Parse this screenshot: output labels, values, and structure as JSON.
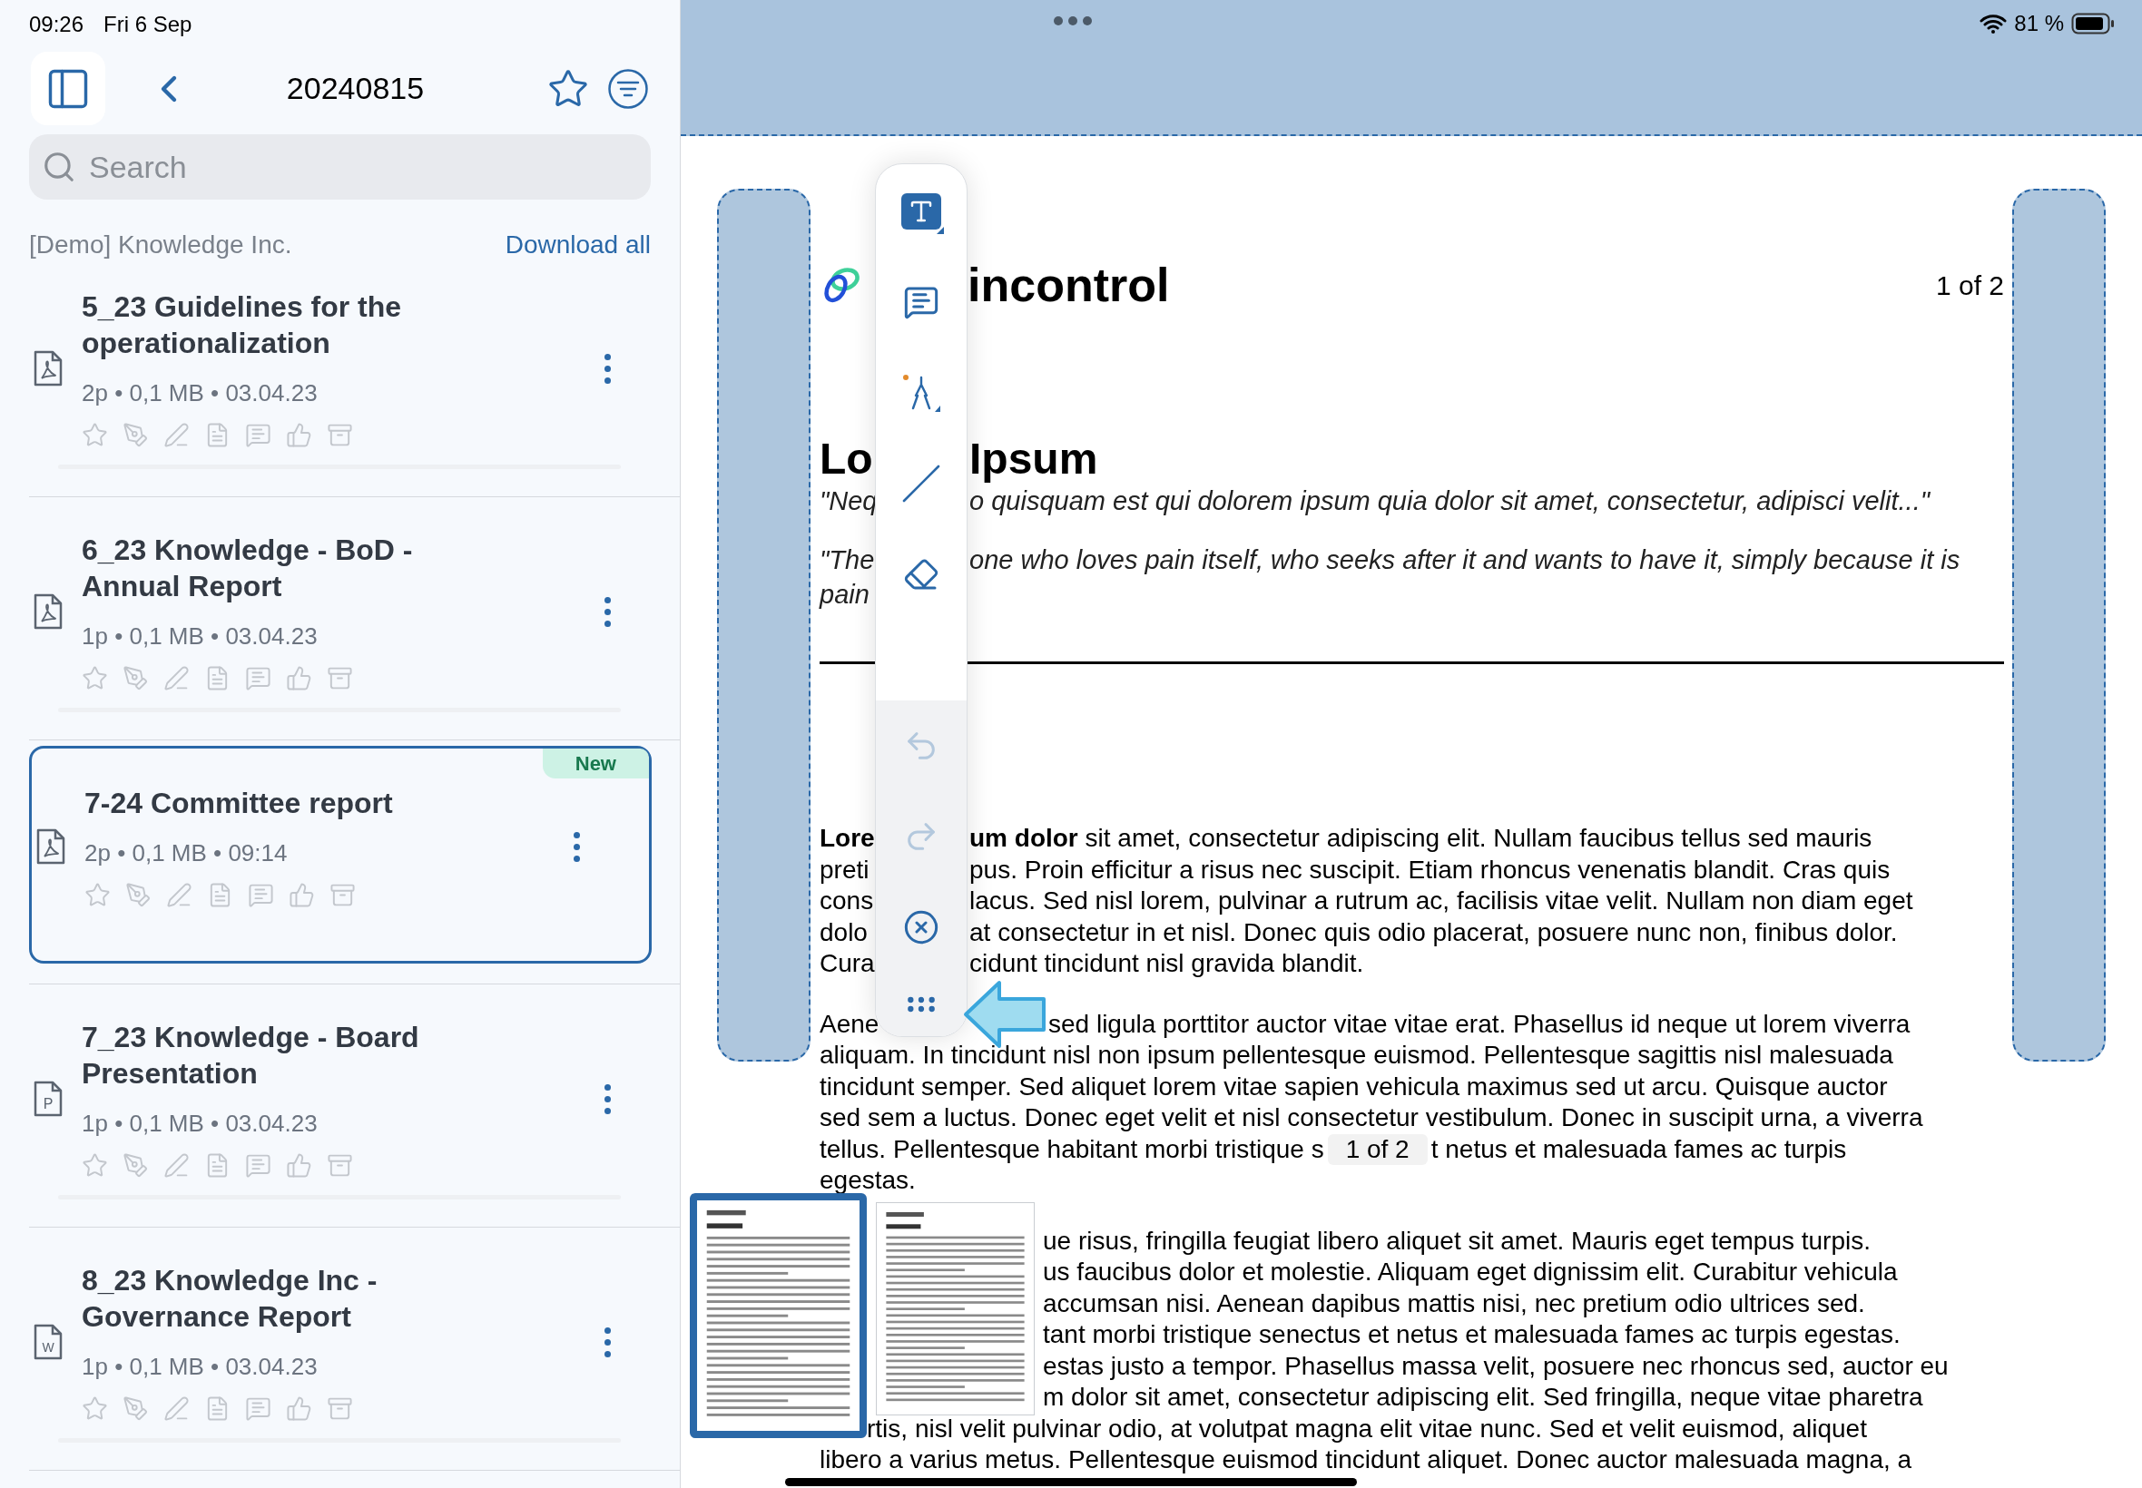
{
  "status_bar": {
    "time": "09:26",
    "date": "Fri 6 Sep",
    "battery": "81 %"
  },
  "header": {
    "title": "20240815"
  },
  "search": {
    "placeholder": "Search"
  },
  "section": {
    "title": "[Demo] Knowledge Inc.",
    "action": "Download all"
  },
  "documents": [
    {
      "title": "5_23 Guidelines for the operationalization",
      "meta": "2p • 0,1 MB • 03.04.23",
      "kind": "pdf",
      "selected": false
    },
    {
      "title": "6_23 Knowledge - BoD - Annual Report",
      "meta": "1p • 0,1 MB • 03.04.23",
      "kind": "pdf",
      "selected": false
    },
    {
      "title": "7-24 Committee report",
      "meta": "2p • 0,1 MB • 09:14",
      "kind": "pdf",
      "selected": true,
      "badge": "New"
    },
    {
      "title": "7_23 Knowledge - Board Presentation",
      "meta": "1p • 0,1 MB • 03.04.23",
      "kind": "ppt",
      "file_letter": "P",
      "selected": false
    },
    {
      "title": "8_23 Knowledge Inc - Governance Report",
      "meta": "1p • 0,1 MB • 03.04.23",
      "kind": "word",
      "file_letter": "W",
      "selected": false
    }
  ],
  "toolbar": {
    "tools": [
      {
        "kind": "text",
        "selected": true
      },
      {
        "kind": "comment",
        "selected": false
      },
      {
        "kind": "pen",
        "selected": false
      },
      {
        "kind": "line",
        "selected": false
      },
      {
        "kind": "eraser",
        "selected": false
      }
    ],
    "actions": [
      {
        "kind": "undo",
        "disabled": true
      },
      {
        "kind": "redo",
        "disabled": true
      },
      {
        "kind": "close",
        "disabled": false
      },
      {
        "kind": "more",
        "disabled": false
      }
    ]
  },
  "document": {
    "logo_text": "incontrol",
    "page_number": "1 of 2",
    "heading_left": "Lo",
    "heading_right": "Ipsum",
    "quotes": [
      {
        "lines": [
          {
            "left": "\"Neq",
            "right": "o quisquam est qui dolorem ipsum quia dolor sit amet, consectetur, adipisci velit...\""
          }
        ]
      },
      {
        "lines": [
          {
            "left": "\"The",
            "right": "one who loves pain itself, who seeks after it and wants to have it, simply because it is"
          },
          {
            "left": "pain"
          }
        ]
      }
    ],
    "paragraphs": [
      {
        "lines": [
          {
            "kind": "split",
            "left": "**Lore**",
            "right": "**um dolor** sit amet, consectetur adipiscing elit. Nullam faucibus tellus sed mauris"
          },
          {
            "kind": "split",
            "left": "preti",
            "right": "pus. Proin efficitur a risus nec suscipit. Etiam rhoncus venenatis blandit. Cras quis"
          },
          {
            "kind": "split",
            "left": "cons",
            "right": "lacus. Sed nisl lorem, pulvinar a rutrum ac, facilisis vitae velit. Nullam non diam eget"
          },
          {
            "kind": "split",
            "left": "dolo",
            "right": "at consectetur in et nisl. Donec quis odio placerat, posuere nunc non, finibus dolor."
          },
          {
            "kind": "split",
            "left": "Cura",
            "right": "cidunt tincidunt nisl gravida blandit."
          }
        ]
      },
      {
        "lines": [
          {
            "kind": "arrow",
            "left": "Aene",
            "right": "sed ligula porttitor auctor vitae vitae erat. Phasellus id neque ut lorem viverra"
          },
          {
            "kind": "full",
            "text": "aliquam. In tincidunt nisl non ipsum pellentesque euismod. Pellentesque sagittis nisl malesuada"
          },
          {
            "kind": "full",
            "text": "tincidunt semper. Sed aliquet lorem vitae sapien vehicula maximus sed ut arcu. Quisque auctor"
          },
          {
            "kind": "full",
            "text": "sed sem a luctus. Donec eget velit et nisl consectetur vestibulum. Donec in suscipit urna, a viverra"
          },
          {
            "kind": "indicator",
            "text": "tellus. Pellentesque habitant morbi tristique s",
            "indicator": "1 of 2",
            "after": "t netus et malesuada fames ac turpis"
          },
          {
            "kind": "full",
            "text": "egestas."
          }
        ]
      },
      {
        "lines": [
          {
            "kind": "thumb",
            "text": "ue risus, fringilla feugiat libero aliquet sit amet. Mauris eget tempus turpis."
          },
          {
            "kind": "thumb",
            "text": "us faucibus dolor et molestie. Aliquam eget dignissim elit. Curabitur vehicula"
          },
          {
            "kind": "thumb",
            "text": "accumsan nisi. Aenean dapibus mattis nisi, nec pretium odio ultrices sed."
          },
          {
            "kind": "thumb",
            "text": "tant morbi tristique senectus et netus et malesuada fames ac turpis egestas."
          },
          {
            "kind": "thumb",
            "text": "estas justo a tempor. Phasellus massa velit, posuere nec rhoncus sed, auctor eu"
          },
          {
            "kind": "thumb",
            "text": "m dolor sit amet, consectetur adipiscing elit. Sed fringilla, neque vitae pharetra"
          },
          {
            "kind": "tail",
            "text": "rtis, nisl velit pulvinar odio, at volutpat magna elit vitae nunc. Sed et velit euismod, aliquet"
          },
          {
            "kind": "full",
            "text": "libero a  varius metus. Pellentesque euismod tincidunt aliquet. Donec auctor malesuada magna, a"
          }
        ]
      }
    ]
  },
  "thumbnails": [
    {
      "selected": true
    },
    {
      "selected": false
    }
  ]
}
